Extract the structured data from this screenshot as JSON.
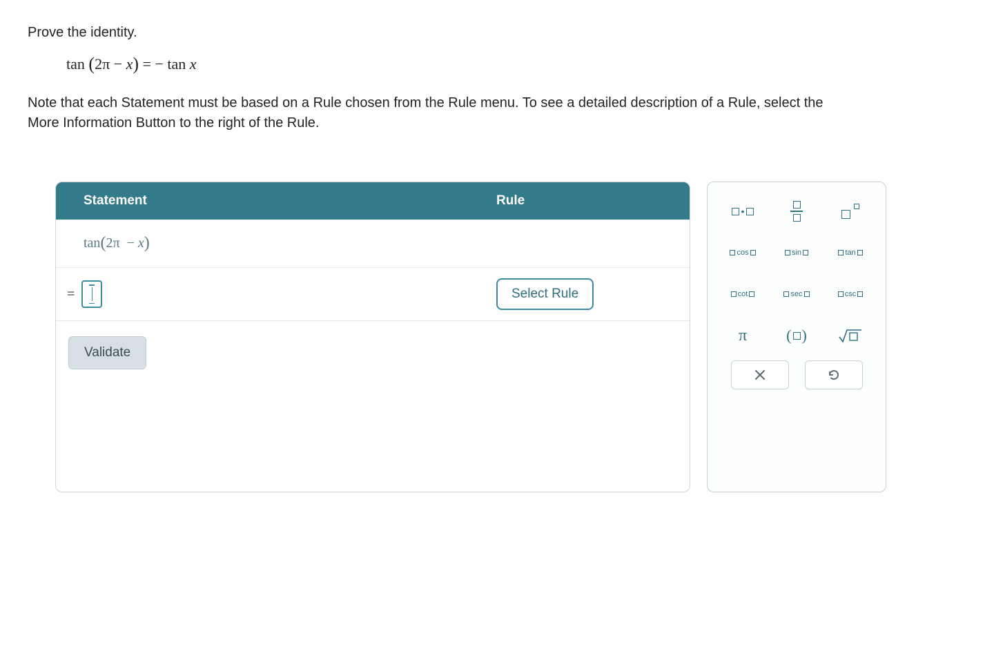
{
  "prompt": {
    "title": "Prove the identity.",
    "identity": "tan (2π − x) = − tan x",
    "note": "Note that each Statement must be based on a Rule chosen from the Rule menu. To see a detailed description of a Rule, select the More Information Button to the right of the Rule."
  },
  "table": {
    "header_statement": "Statement",
    "header_rule": "Rule",
    "row0_expr": "tan (2π − x)",
    "row1_eq": "=",
    "select_rule_label": "Select Rule",
    "validate_label": "Validate"
  },
  "palette": {
    "pi": "π",
    "parens": "( )",
    "cos": "cos",
    "sin": "sin",
    "tan": "tan",
    "cot": "cot",
    "sec": "sec",
    "csc": "csc",
    "close": "✕",
    "undo": "↺"
  }
}
